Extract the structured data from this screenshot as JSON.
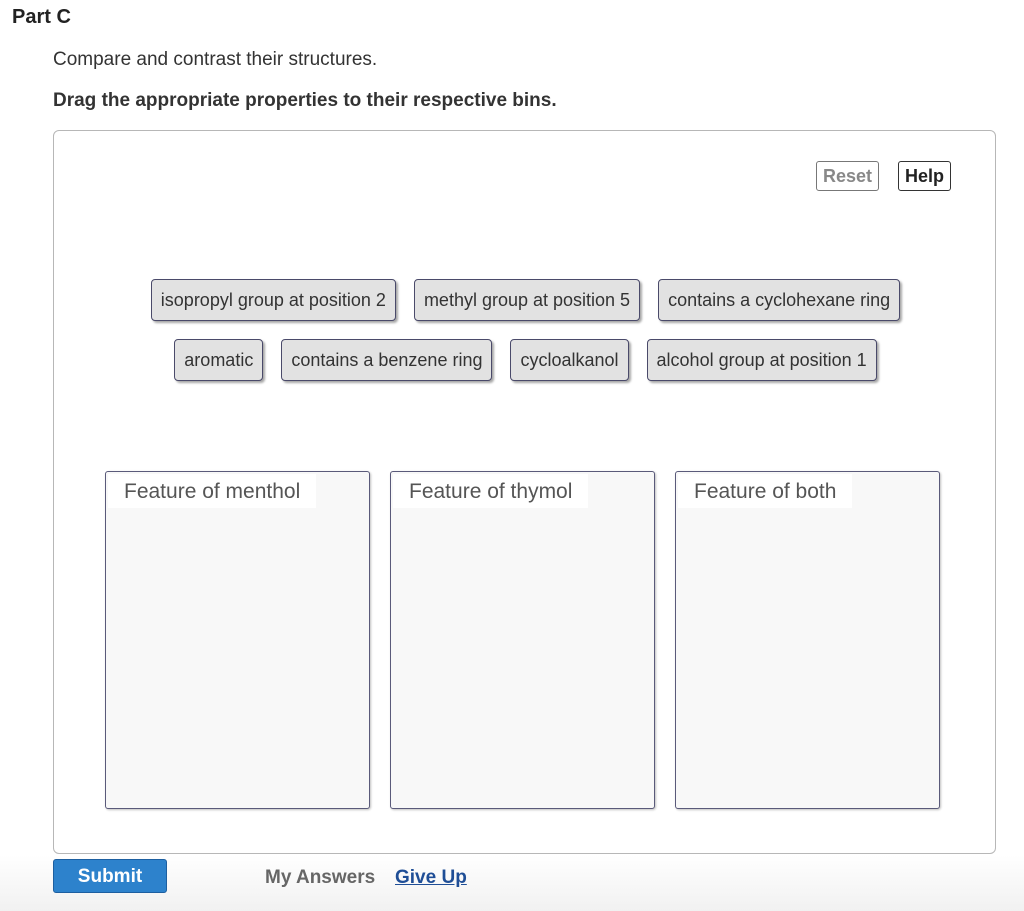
{
  "part": {
    "title": "Part C",
    "prompt": "Compare and contrast their structures.",
    "instruction": "Drag the appropriate properties to their respective bins."
  },
  "toolbar": {
    "reset_label": "Reset",
    "help_label": "Help"
  },
  "tiles": {
    "row1": [
      "isopropyl group at position 2",
      "methyl group at position 5",
      "contains a cyclohexane ring"
    ],
    "row2": [
      "aromatic",
      "contains a benzene ring",
      "cycloalkanol",
      "alcohol group at position 1"
    ]
  },
  "bins": [
    {
      "label": "Feature of menthol"
    },
    {
      "label": "Feature of thymol"
    },
    {
      "label": "Feature of both"
    }
  ],
  "footer": {
    "submit_label": "Submit",
    "my_answers_label": "My Answers",
    "give_up_label": "Give Up"
  },
  "colors": {
    "submit_bg": "#2d82cc",
    "link": "#1f4e96",
    "tile_bg": "#e2e2e2",
    "bin_bg": "#f8f8f8"
  }
}
